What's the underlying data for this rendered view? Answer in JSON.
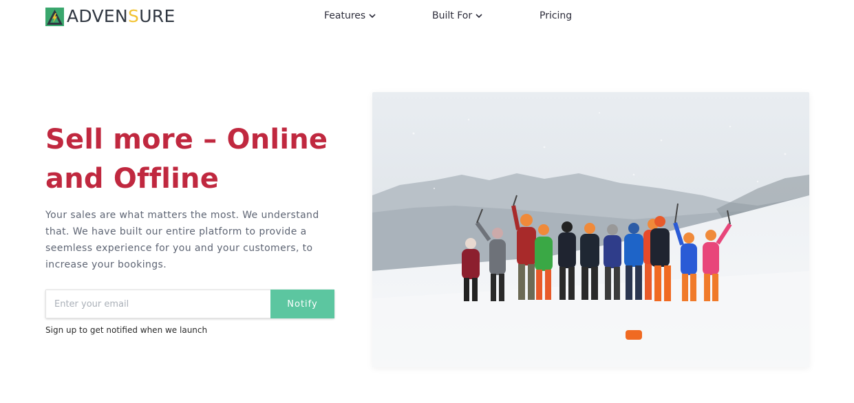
{
  "brand": {
    "name_part_a": "ADVEN",
    "name_part_b": "S",
    "name_part_c": "URE",
    "colors": {
      "green": "#3aa76d",
      "yellow": "#f2c230",
      "dark": "#2f3640"
    }
  },
  "nav": {
    "items": [
      {
        "label": "Features",
        "has_dropdown": true,
        "icon": "chevron-down-icon"
      },
      {
        "label": "Built For",
        "has_dropdown": true,
        "icon": "chevron-down-icon"
      },
      {
        "label": "Pricing",
        "has_dropdown": false
      }
    ]
  },
  "hero": {
    "title_line1": "Sell more – Online",
    "title_line2": "and Offline",
    "description": "Your sales are what matters the most. We understand that. We have built our entire platform to provide a seemless experience for you and your customers, to increase your bookings.",
    "email_placeholder": "Enter your email",
    "email_value": "",
    "notify_label": "Notify",
    "signup_hint": "Sign up to get notified when we launch",
    "image_subject": "group of climbers posing on a snowy glacier"
  },
  "colors": {
    "title": "#c0283f",
    "accent_button": "#5cc6a0",
    "body_text": "#5d6473"
  }
}
